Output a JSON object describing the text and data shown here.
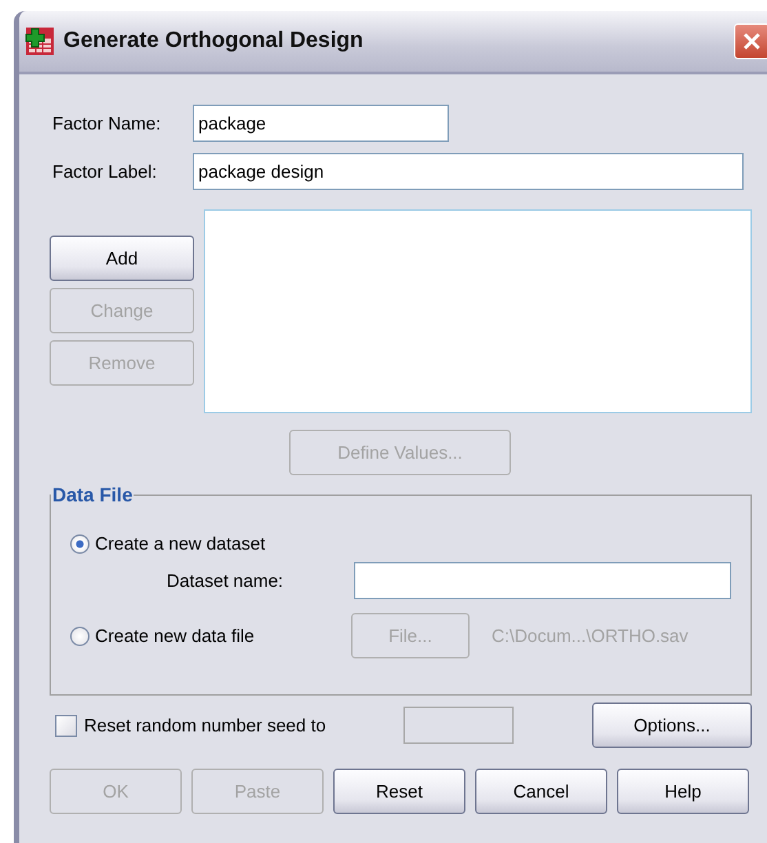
{
  "window": {
    "title": "Generate Orthogonal Design"
  },
  "factor_name": {
    "label": "Factor Name:",
    "value": "package"
  },
  "factor_label": {
    "label": "Factor Label:",
    "value": "package design"
  },
  "list_buttons": [
    {
      "label": "Add",
      "disabled": false
    },
    {
      "label": "Change",
      "disabled": true
    },
    {
      "label": "Remove",
      "disabled": true
    }
  ],
  "define_values": {
    "label": "Define Values...",
    "disabled": true
  },
  "data_file": {
    "title": "Data File",
    "options": [
      {
        "label": "Create a new dataset",
        "selected": true
      },
      {
        "label": "Create new data file",
        "selected": false
      }
    ],
    "dataset_name": {
      "label": "Dataset name:"
    },
    "file_button": {
      "label": "File...",
      "disabled": true
    },
    "path": "C:\\Docum...\\ORTHO.sav"
  },
  "seed": {
    "label": "Reset random number seed to",
    "checked": false
  },
  "options_button": {
    "label": "Options...",
    "disabled": false
  },
  "buttons": [
    {
      "label": "OK",
      "disabled": true
    },
    {
      "label": "Paste",
      "disabled": true
    },
    {
      "label": "Reset",
      "disabled": false
    },
    {
      "label": "Cancel",
      "disabled": false
    },
    {
      "label": "Help",
      "disabled": false
    }
  ]
}
